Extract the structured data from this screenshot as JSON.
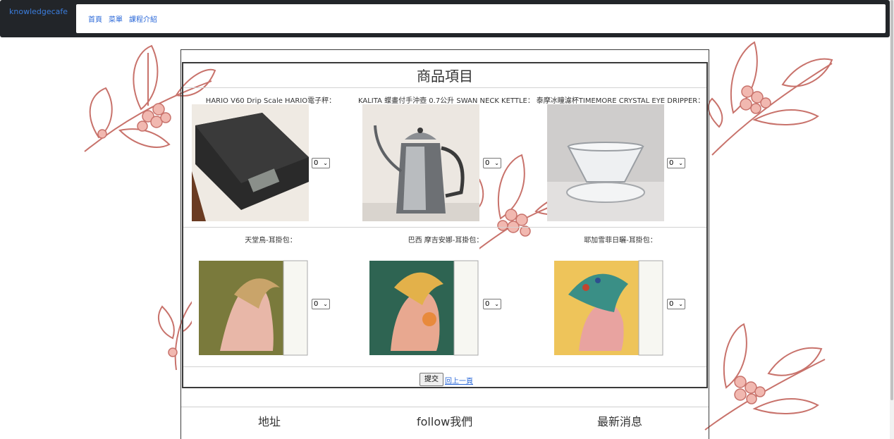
{
  "navbar": {
    "brand": "knowledgecafe",
    "links": [
      "首頁",
      "菜單",
      "課程介紹"
    ]
  },
  "products": {
    "title": "商品項目",
    "items": [
      {
        "label": "HARIO V60 Drip Scale HARIO電子秤：",
        "quantity": "0"
      },
      {
        "label": "KALITA 蝶畫付手沖壺 0.7公升 SWAN NECK KETTLE：",
        "quantity": "0"
      },
      {
        "label": "泰摩冰瞳濾杯TIMEMORE CRYSTAL EYE DRIPPER：",
        "quantity": "0"
      },
      {
        "label": "天堂鳥-耳掛包：",
        "quantity": "0"
      },
      {
        "label": "巴西 摩吉安娜-耳掛包：",
        "quantity": "0"
      },
      {
        "label": "耶加雪菲日曬-耳掛包：",
        "quantity": "0"
      }
    ],
    "submit_label": "提交",
    "back_label": "回上一頁"
  },
  "footer": {
    "address": "地址",
    "follow": "follow我們",
    "news": "最新消息"
  },
  "colors": {
    "navbar_bg": "#222529",
    "link": "#2b68d8",
    "sprig": "#c8726b",
    "berry": "#f1b8b0"
  }
}
